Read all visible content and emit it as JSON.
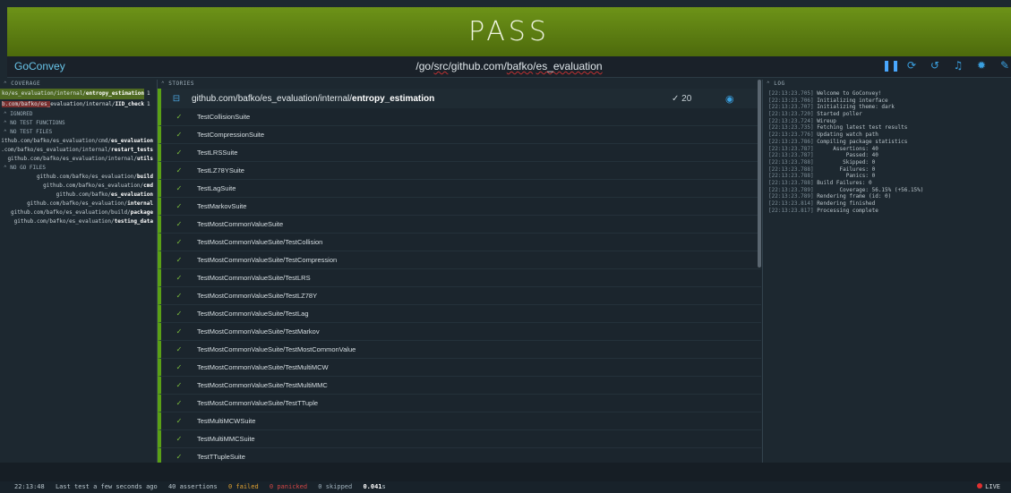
{
  "banner": {
    "status": "PASS"
  },
  "topbar": {
    "brand": "GoConvey",
    "path_pre": "/go/",
    "path_u1": "src",
    "path_mid": "/github.com/",
    "path_u2": "bafko",
    "path_sep": "/",
    "path_u3": "es_evaluation",
    "controls": [
      "pause-icon",
      "refresh-icon",
      "history-icon",
      "bell-icon",
      "gear-icon",
      "edit-icon"
    ]
  },
  "coverage": {
    "header": "COVERAGE",
    "items": [
      {
        "path": "ko/es_evaluation/internal/",
        "name": "entropy_estimation",
        "pct": "1",
        "color": "#5e7a2a"
      },
      {
        "path": "b.com/bafko/es_",
        "path2": "evaluation/internal/",
        "name": "IID_check",
        "pct": "1",
        "color": "#7a3030"
      }
    ]
  },
  "ignored": {
    "header": "IGNORED"
  },
  "no_test_functions": {
    "header": "NO TEST FUNCTIONS"
  },
  "no_test_files": {
    "header": "NO TEST FILES",
    "items": [
      {
        "path": "ithub.com/bafko/es_evaluation/cmd/",
        "name": "es_evaluation"
      },
      {
        "path": ".com/bafko/es_evaluation/internal/",
        "name": "restart_tests"
      },
      {
        "path": "github.com/bafko/es_evaluation/internal/",
        "name": "utils"
      }
    ]
  },
  "no_go_files": {
    "header": "NO GO FILES",
    "items": [
      {
        "path": "github.com/bafko/es_evaluation/",
        "name": "build"
      },
      {
        "path": "github.com/bafko/es_evaluation/",
        "name": "cmd"
      },
      {
        "path": "github.com/bafko/",
        "name": "es_evaluation"
      },
      {
        "path": "github.com/bafko/es_evaluation/",
        "name": "internal"
      },
      {
        "path": "github.com/bafko/es_evaluation/build/",
        "name": "package"
      },
      {
        "path": "github.com/bafko/es_evaluation/",
        "name": "testing_data"
      }
    ]
  },
  "stories": {
    "header": "STORIES",
    "package": {
      "path": "github.com/bafko/es_evaluation/internal/",
      "name": "entropy_estimation",
      "count": "✓ 20"
    },
    "tests": [
      "TestCollisionSuite",
      "TestCompressionSuite",
      "TestLRSSuite",
      "TestLZ78YSuite",
      "TestLagSuite",
      "TestMarkovSuite",
      "TestMostCommonValueSuite",
      "TestMostCommonValueSuite/TestCollision",
      "TestMostCommonValueSuite/TestCompression",
      "TestMostCommonValueSuite/TestLRS",
      "TestMostCommonValueSuite/TestLZ78Y",
      "TestMostCommonValueSuite/TestLag",
      "TestMostCommonValueSuite/TestMarkov",
      "TestMostCommonValueSuite/TestMostCommonValue",
      "TestMostCommonValueSuite/TestMultiMCW",
      "TestMostCommonValueSuite/TestMultiMMC",
      "TestMostCommonValueSuite/TestTTuple",
      "TestMultiMCWSuite",
      "TestMultiMMCSuite",
      "TestTTupleSuite"
    ]
  },
  "log": {
    "header": "LOG",
    "lines": [
      {
        "ts": "[22:13:23.705]",
        "msg": " Welcome to GoConvey!"
      },
      {
        "ts": "[22:13:23.706]",
        "msg": " Initializing interface"
      },
      {
        "ts": "[22:13:23.707]",
        "msg": " Initializing theme: dark"
      },
      {
        "ts": "[22:13:23.720]",
        "msg": " Started poller"
      },
      {
        "ts": "[22:13:23.724]",
        "msg": " Wireup"
      },
      {
        "ts": "[22:13:23.735]",
        "msg": " Fetching latest test results"
      },
      {
        "ts": "[22:13:23.776]",
        "msg": " Updating watch path"
      },
      {
        "ts": "[22:13:23.786]",
        "msg": " Compiling package statistics"
      },
      {
        "ts": "[22:13:23.787]",
        "msg": "      Assertions: 40"
      },
      {
        "ts": "[22:13:23.787]",
        "msg": "          Passed: 40"
      },
      {
        "ts": "[22:13:23.788]",
        "msg": "         Skipped: 0"
      },
      {
        "ts": "[22:13:23.788]",
        "msg": "        Failures: 0"
      },
      {
        "ts": "[22:13:23.788]",
        "msg": "          Panics: 0"
      },
      {
        "ts": "[22:13:23.788]",
        "msg": " Build Failures: 0"
      },
      {
        "ts": "[22:13:23.789]",
        "msg": "        Coverage: 56.15% (+56.15%)"
      },
      {
        "ts": "[22:13:23.789]",
        "msg": " Rendering frame (id: 0)"
      },
      {
        "ts": "[22:13:23.814]",
        "msg": " Rendering finished"
      },
      {
        "ts": "[22:13:23.817]",
        "msg": " Processing complete"
      }
    ]
  },
  "footer": {
    "time": "22:13:48",
    "last_test": "Last test a few seconds ago",
    "assertions": "40 assertions",
    "failed": "0 failed",
    "panicked": "0 panicked",
    "skipped": "0 skipped",
    "duration": "0.041",
    "duration_unit": "s",
    "live": "LIVE"
  }
}
